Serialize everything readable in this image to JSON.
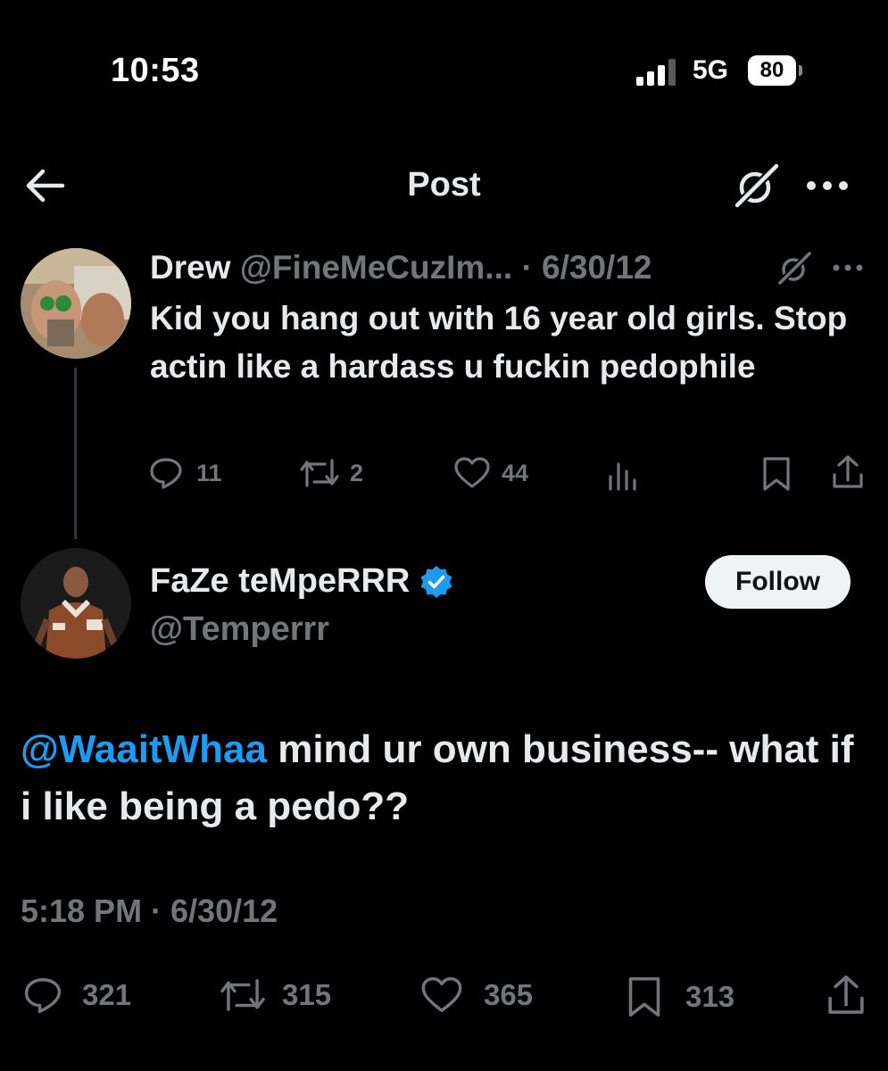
{
  "status_bar": {
    "time": "10:53",
    "network": "5G",
    "battery": "80"
  },
  "header": {
    "title": "Post"
  },
  "reply_tweet": {
    "display_name": "Drew",
    "handle": "@FineMeCuzIm...",
    "separator": "·",
    "date": "6/30/12",
    "text": "Kid you hang out with 16 year old girls. Stop actin like a hardass u fuckin pedophile",
    "replies": "11",
    "retweets": "2",
    "likes": "44"
  },
  "main_tweet": {
    "display_name": "FaZe teMpeRRR",
    "handle": "@Temperrr",
    "follow_label": "Follow",
    "mention": "@WaaitWhaa",
    "text": " mind ur own business-- what if i like being a pedo??",
    "timestamp": "5:18 PM · 6/30/12",
    "replies": "321",
    "retweets": "315",
    "likes": "365",
    "bookmarks": "313"
  },
  "colors": {
    "background": "#000000",
    "text": "#e7e9ea",
    "secondary": "#71767b",
    "accent": "#1d9bf0"
  },
  "icons": [
    "back-arrow-icon",
    "grok-icon",
    "more-icon",
    "reply-icon",
    "retweet-icon",
    "like-icon",
    "views-icon",
    "bookmark-icon",
    "share-icon",
    "verified-badge-icon"
  ]
}
